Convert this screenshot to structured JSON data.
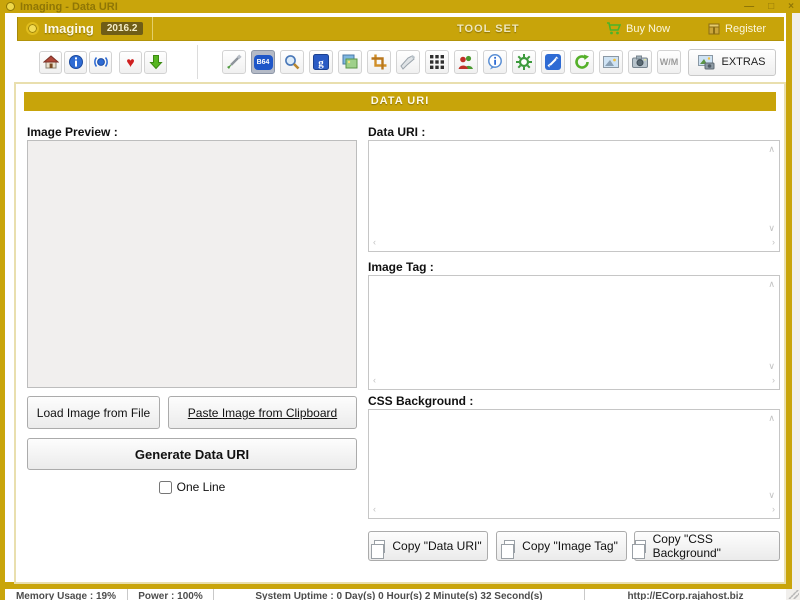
{
  "window": {
    "title": "Imaging - Data URI",
    "controls": {
      "minimize": "—",
      "maximize": "□",
      "close": "×"
    }
  },
  "header": {
    "brand": "Imaging",
    "version": "2016.2",
    "center_label": "TOOL SET",
    "buy_now_label": "Buy Now",
    "register_label": "Register"
  },
  "toolbar": {
    "nav_icons": [
      "home-icon",
      "about-icon",
      "sync-icon",
      "favorite-icon",
      "download-icon"
    ],
    "tool_icons": [
      "color-picker-icon",
      "base64-icon",
      "zoom-icon",
      "google-icon",
      "gallery-icon",
      "crop-icon",
      "clean-icon",
      "pixel-grid-icon",
      "users-icon",
      "tooltip-info-icon",
      "settings-gear-icon",
      "resize-icon",
      "refresh-icon",
      "picture-icon",
      "camera-icon",
      "watermark-icon"
    ],
    "b64_label": "B64",
    "wm_label": "W/M",
    "extras_label": "EXTRAS"
  },
  "section": {
    "title": "DATA URI"
  },
  "left_panel": {
    "image_preview_label": "Image Preview :",
    "load_button": "Load Image from File",
    "paste_button": "Paste Image from Clipboard",
    "generate_button": "Generate Data URI",
    "one_line_label": "One Line"
  },
  "right_panel": {
    "data_uri_label": "Data URI :",
    "image_tag_label": "Image Tag :",
    "css_background_label": "CSS Background :",
    "data_uri_value": "",
    "image_tag_value": "",
    "css_background_value": "",
    "copy_data_uri_button": "Copy \"Data URI\"",
    "copy_image_tag_button": "Copy \"Image Tag\"",
    "copy_css_background_button": "Copy \"CSS Background\""
  },
  "status_bar": {
    "memory": "Memory Usage : 19%",
    "power": "Power : 100%",
    "uptime": "System Uptime : 0 Day(s) 0 Hour(s) 2 Minute(s) 32 Second(s)",
    "url": "http://ECorp.rajahost.biz"
  },
  "colors": {
    "gold": "#c8a40a",
    "badge_bg": "#6f5d17",
    "panel_border": "#e9dfae",
    "preview_bg": "#f1efee",
    "status_text": "#4d4d4d"
  }
}
